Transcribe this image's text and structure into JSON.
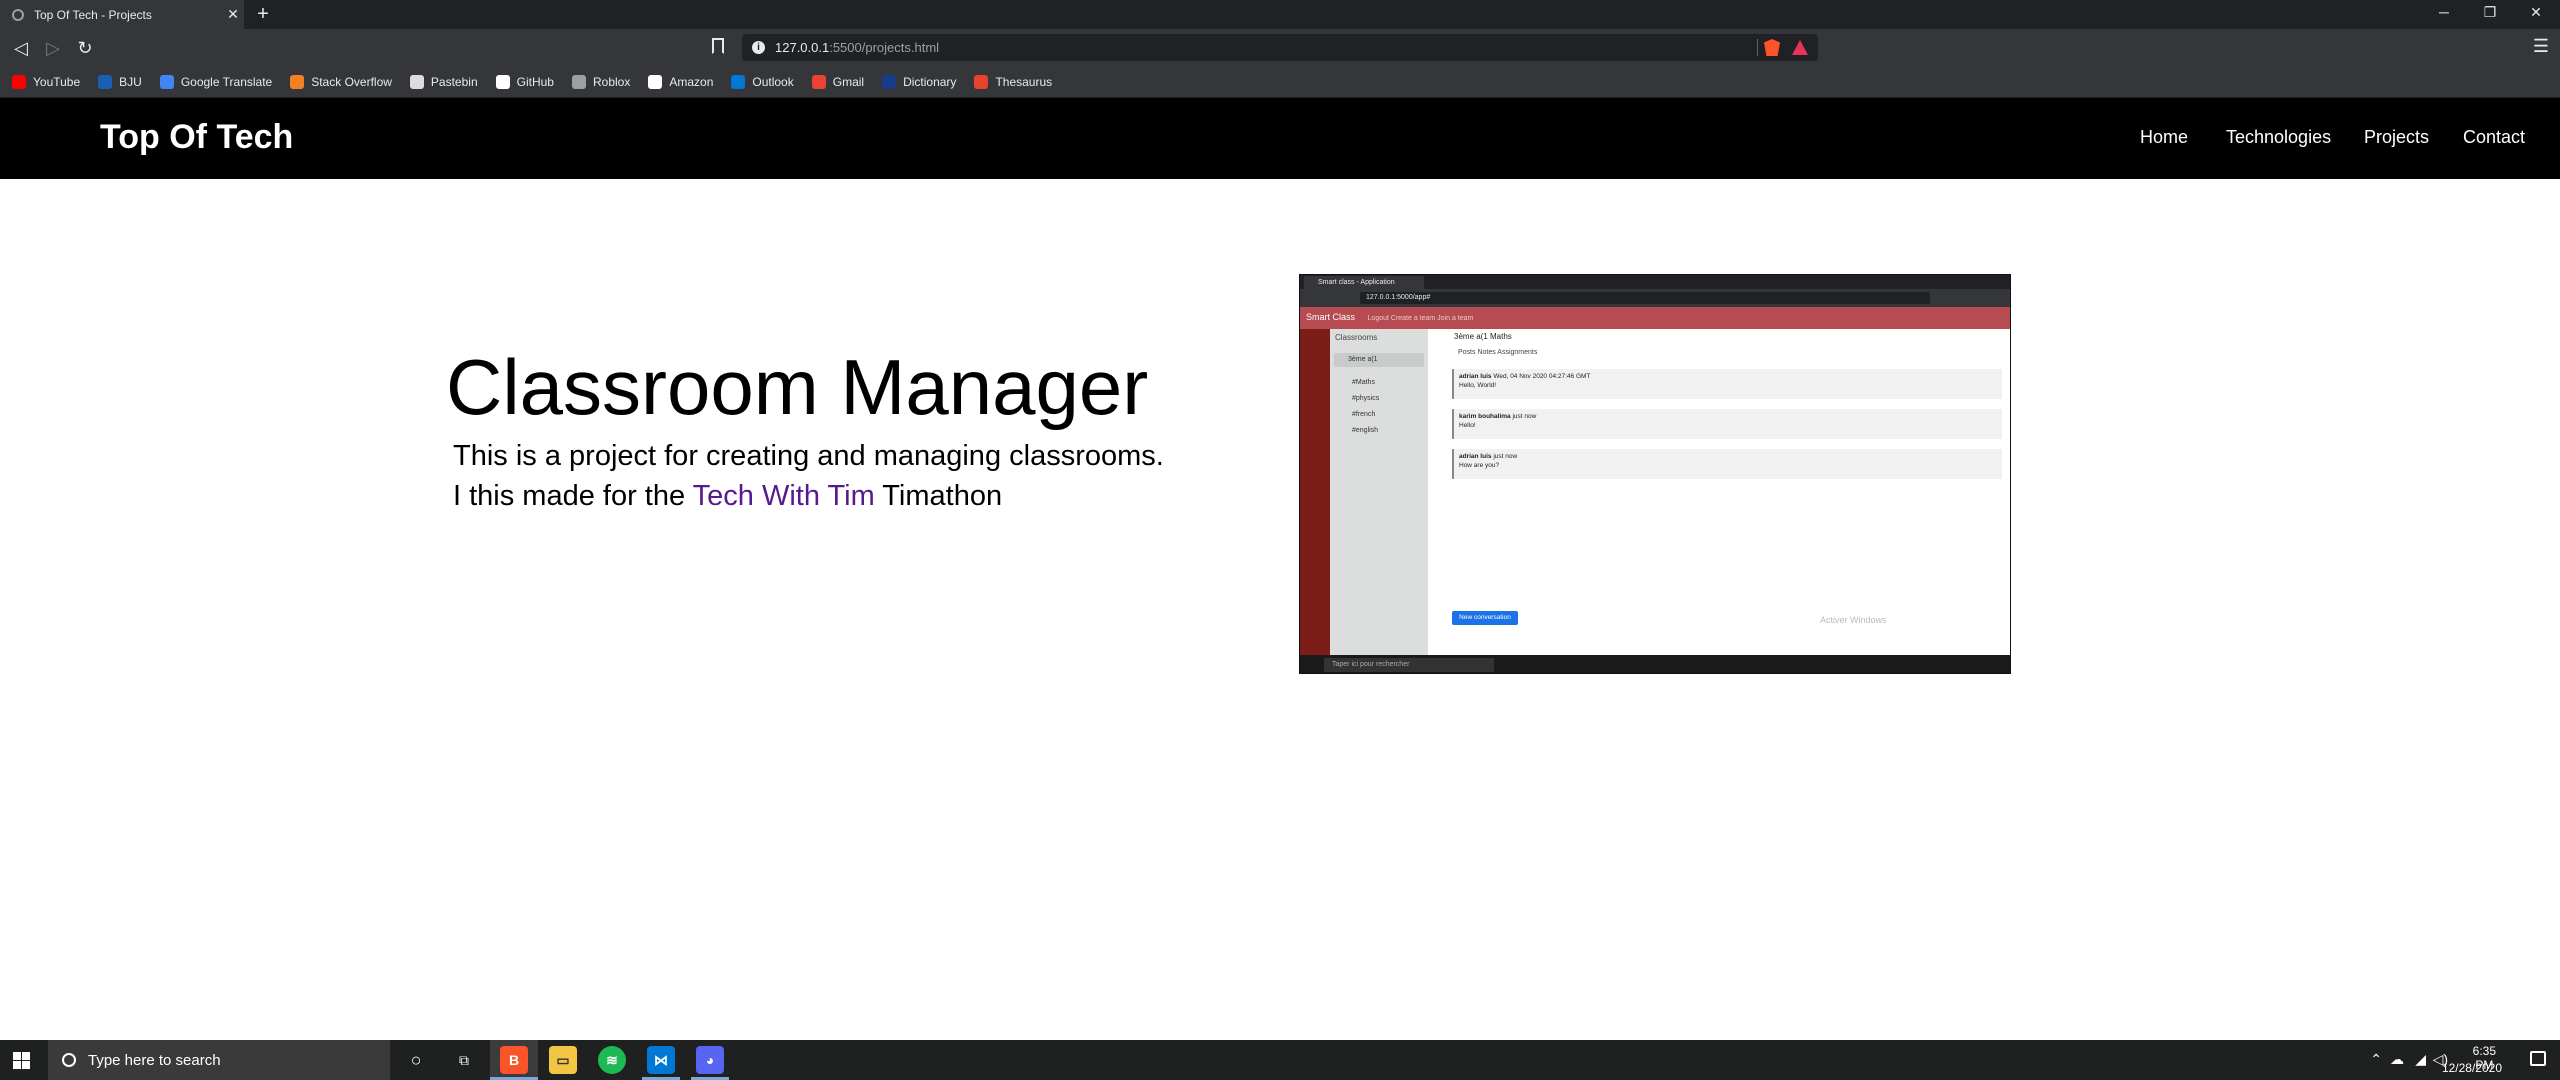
{
  "browser": {
    "tab_title": "Top Of Tech - Projects",
    "url_host": "127.0.0.1",
    "url_path": ":5500/projects.html",
    "bookmarks": [
      {
        "label": "YouTube",
        "icon": "youtube-icon",
        "color": "#ff0000"
      },
      {
        "label": "BJU",
        "icon": "bju-icon",
        "color": "#1a5fb4"
      },
      {
        "label": "Google Translate",
        "icon": "translate-icon",
        "color": "#4285f4"
      },
      {
        "label": "Stack Overflow",
        "icon": "stackoverflow-icon",
        "color": "#f48024"
      },
      {
        "label": "Pastebin",
        "icon": "pastebin-icon",
        "color": "#dddddd"
      },
      {
        "label": "GitHub",
        "icon": "github-icon",
        "color": "#ffffff"
      },
      {
        "label": "Roblox",
        "icon": "roblox-icon",
        "color": "#9aa0a6"
      },
      {
        "label": "Amazon",
        "icon": "amazon-icon",
        "color": "#ffffff"
      },
      {
        "label": "Outlook",
        "icon": "outlook-icon",
        "color": "#0078d4"
      },
      {
        "label": "Gmail",
        "icon": "gmail-icon",
        "color": "#ea4335"
      },
      {
        "label": "Dictionary",
        "icon": "dictionary-icon",
        "color": "#1a3a8a"
      },
      {
        "label": "Thesaurus",
        "icon": "thesaurus-icon",
        "color": "#e8432d"
      }
    ]
  },
  "site": {
    "brand": "Top Of Tech",
    "nav": [
      "Home",
      "Technologies",
      "Projects",
      "Contact"
    ]
  },
  "project": {
    "title": "Classroom Manager",
    "line1": "This is a project for creating and managing classrooms.",
    "line2_before": "I this made for the ",
    "line2_link": "Tech With Tim",
    "line2_after": " Timathon"
  },
  "screenshot": {
    "tab": "Smart class - Application",
    "url": "127.0.0.1:5000/app#",
    "app_name": "Smart Class",
    "app_links": "Logout   Create a team   Join a team",
    "sidebar_header": "Classrooms",
    "classroom": "3ème a(1",
    "channels": [
      "#Maths",
      "#physics",
      "#french",
      "#english"
    ],
    "channel_header": "3ème a(1  Maths",
    "subtabs": "Posts    Notes    Assignments",
    "messages": [
      {
        "author": "adrian luis",
        "time": "Wed, 04 Nov 2020 04:27:46 GMT",
        "text": "Hello, World!"
      },
      {
        "author": "karim bouhalima",
        "time": "just now",
        "text": "Hello!"
      },
      {
        "author": "adrian luis",
        "time": "just now",
        "text": "How are you?"
      }
    ],
    "new_conversation": "New conversation",
    "activate": "Activer Windows",
    "taskbar_search": "Taper ici pour rechercher"
  },
  "taskbar": {
    "search_placeholder": "Type here to search",
    "time": "6:35 PM",
    "date": "12/28/2020"
  }
}
